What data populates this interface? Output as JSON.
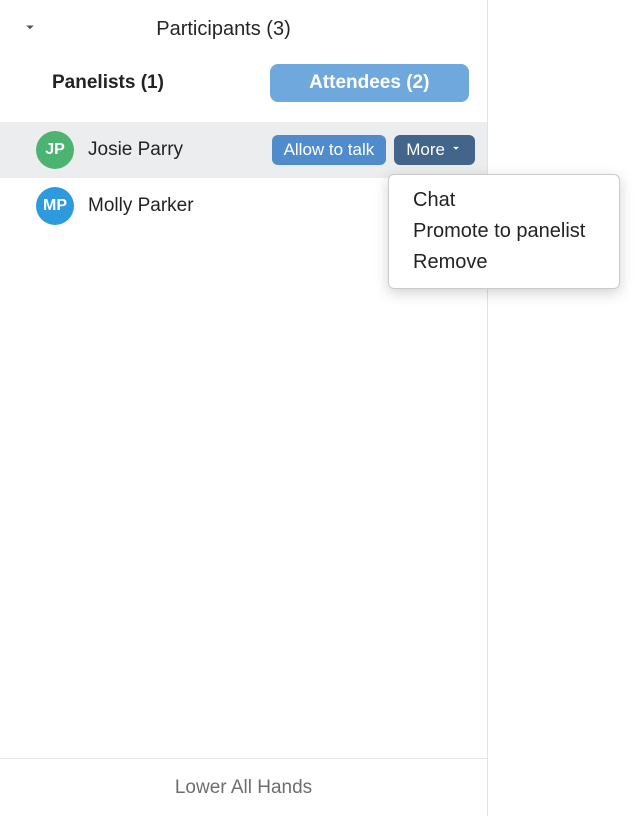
{
  "header": {
    "title": "Participants (3)"
  },
  "tabs": {
    "panelists_label": "Panelists (1)",
    "attendees_label": "Attendees (2)"
  },
  "attendees": [
    {
      "initials": "JP",
      "name": "Josie Parry",
      "avatar_color": "green",
      "active": true
    },
    {
      "initials": "MP",
      "name": "Molly Parker",
      "avatar_color": "blue",
      "active": false
    }
  ],
  "row_actions": {
    "allow_to_talk_label": "Allow to talk",
    "more_label": "More"
  },
  "more_menu": {
    "items": [
      "Chat",
      "Promote to panelist",
      "Remove"
    ]
  },
  "footer": {
    "lower_all_hands_label": "Lower All Hands"
  }
}
